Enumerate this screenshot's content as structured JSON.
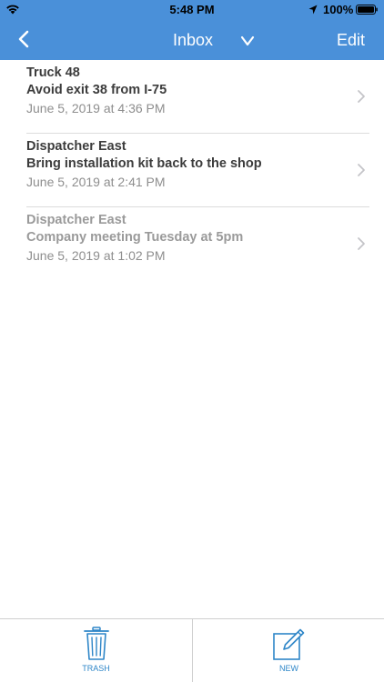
{
  "status_bar": {
    "time": "5:48 PM",
    "battery_percent": "100%",
    "icons": [
      "wifi-icon",
      "location-arrow-icon",
      "battery-icon"
    ]
  },
  "nav": {
    "title": "Inbox",
    "edit_label": "Edit",
    "icons": [
      "chevron-left-icon",
      "chevron-down-icon"
    ]
  },
  "messages": [
    {
      "sender": "Truck 48",
      "subject": "Avoid exit 38 from I-75",
      "date": "June 5, 2019 at 4:36 PM",
      "read": false
    },
    {
      "sender": "Dispatcher East",
      "subject": "Bring installation kit back to the shop",
      "date": "June 5, 2019 at 2:41 PM",
      "read": false
    },
    {
      "sender": "Dispatcher East",
      "subject": "Company meeting Tuesday at 5pm",
      "date": "June 5, 2019 at 1:02 PM",
      "read": true
    }
  ],
  "toolbar": {
    "trash_label": "TRASH",
    "new_label": "NEW",
    "icons": [
      "trash-icon",
      "compose-icon"
    ]
  },
  "colors": {
    "nav_background": "#4a90d9",
    "toolbar_accent": "#2e86c8",
    "unread_text": "#3c3c3c",
    "read_text": "#9a9a9a",
    "date_text": "#8e8e8e"
  }
}
